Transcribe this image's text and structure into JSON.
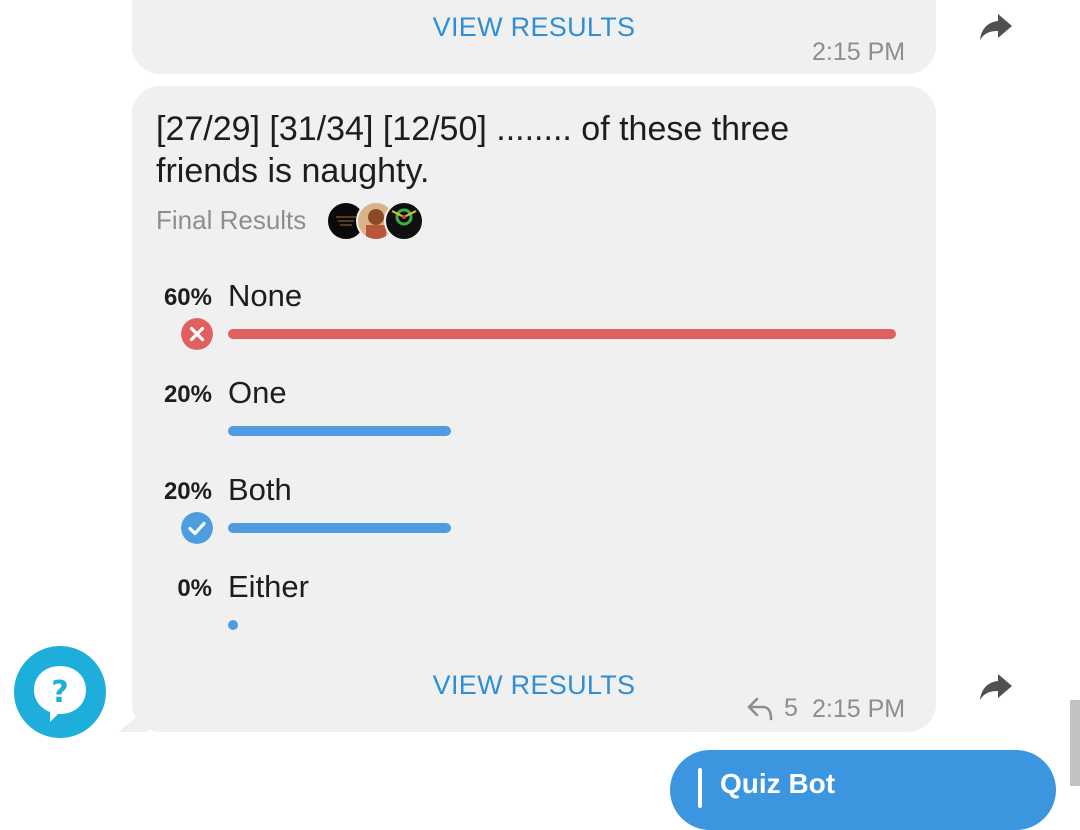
{
  "top_message": {
    "view_results": "VIEW RESULTS",
    "time": "2:15 PM"
  },
  "poll": {
    "question": "[27/29] [31/34] [12/50] ........ of these three friends is naughty.",
    "status": "Final Results",
    "options": [
      {
        "percent": "60%",
        "label": "None",
        "share": 0.6,
        "bar_color": "#e06060",
        "mark": "wrong"
      },
      {
        "percent": "20%",
        "label": "One",
        "share": 0.2,
        "bar_color": "#4d9de0",
        "mark": ""
      },
      {
        "percent": "20%",
        "label": "Both",
        "share": 0.2,
        "bar_color": "#4d9de0",
        "mark": "correct"
      },
      {
        "percent": "0%",
        "label": "Either",
        "share": 0.0,
        "bar_color": "#4d9de0",
        "mark": ""
      }
    ],
    "view_results": "VIEW RESULTS",
    "reply_count": "5",
    "time": "2:15 PM"
  },
  "outgoing": {
    "reply_preview": "Quiz Bot"
  },
  "icons": {
    "share": "share-forward-icon",
    "help": "question-help-icon",
    "reply": "reply-arrow-icon",
    "wrong": "x-circle-icon",
    "correct": "check-circle-icon"
  },
  "colors": {
    "accent": "#2f8ed6",
    "wrong": "#e06060",
    "correct": "#4d9de0",
    "help": "#1eaedc"
  }
}
